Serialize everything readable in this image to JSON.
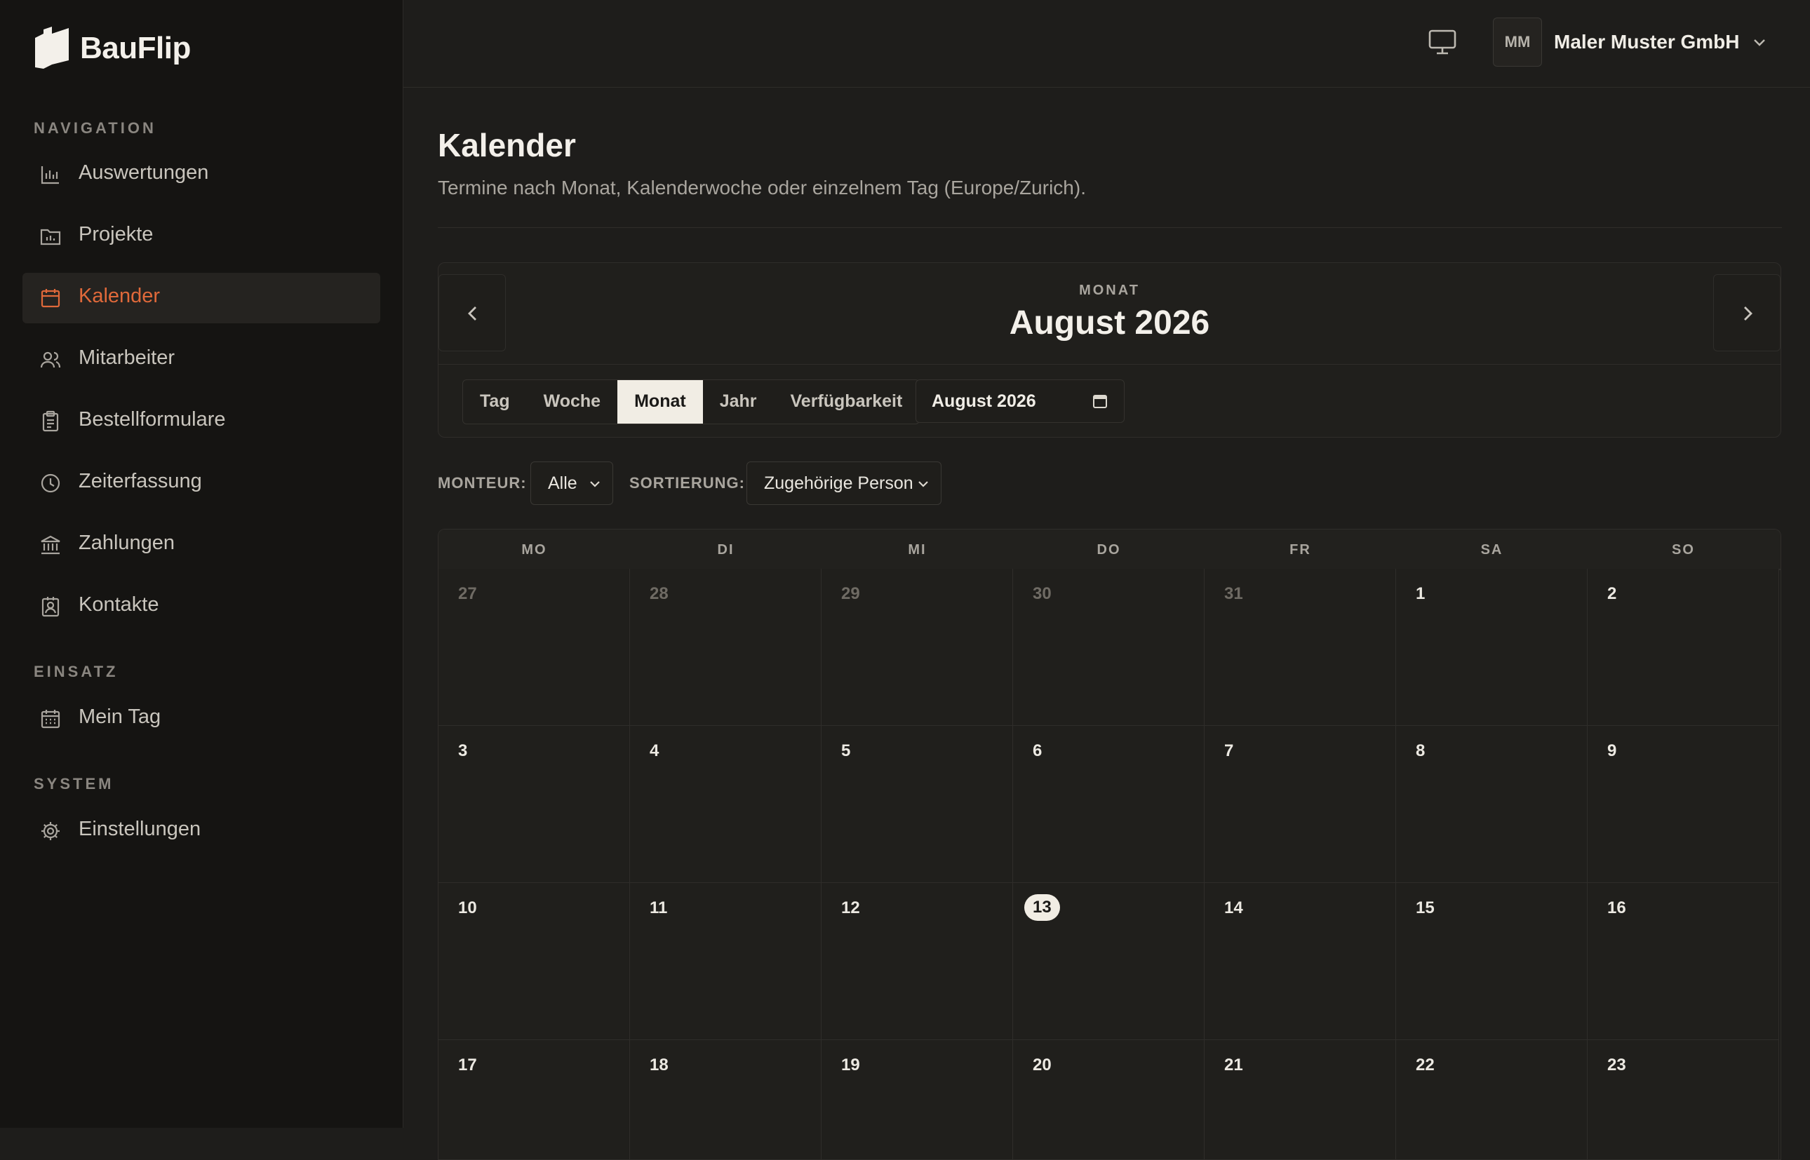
{
  "app": {
    "name": "BauFlip"
  },
  "sidebar": {
    "sections": [
      {
        "label": "NAVIGATION"
      },
      {
        "label": "EINSATZ"
      },
      {
        "label": "SYSTEM"
      }
    ],
    "items": [
      {
        "label": "Auswertungen",
        "icon": "bar-chart-icon"
      },
      {
        "label": "Projekte",
        "icon": "folder-chart-icon"
      },
      {
        "label": "Kalender",
        "icon": "calendar-icon",
        "active": true
      },
      {
        "label": "Mitarbeiter",
        "icon": "users-icon"
      },
      {
        "label": "Bestellformulare",
        "icon": "clipboard-icon"
      },
      {
        "label": "Zeiterfassung",
        "icon": "clock-icon"
      },
      {
        "label": "Zahlungen",
        "icon": "bank-icon"
      },
      {
        "label": "Kontakte",
        "icon": "contact-icon"
      },
      {
        "label": "Mein Tag",
        "icon": "calendar-grid-icon"
      },
      {
        "label": "Einstellungen",
        "icon": "gear-icon"
      }
    ],
    "accent_color": "#e0693a"
  },
  "header": {
    "avatar_initials": "MM",
    "company": "Maler Muster GmbH"
  },
  "page": {
    "title": "Kalender",
    "subtitle": "Termine nach Monat, Kalenderwoche oder einzelnem Tag (Europe/Zurich)."
  },
  "calendar": {
    "period_label": "MONAT",
    "period_title": "August 2026",
    "views": [
      "Tag",
      "Woche",
      "Monat",
      "Jahr",
      "Verfügbarkeit"
    ],
    "active_view": "Monat",
    "month_picker_value": "August 2026",
    "filters": {
      "monteur_label": "MONTEUR:",
      "monteur_value": "Alle",
      "sort_label": "SORTIERUNG:",
      "sort_value": "Zugehörige Person"
    },
    "weekdays": [
      "MO",
      "DI",
      "MI",
      "DO",
      "FR",
      "SA",
      "SO"
    ],
    "weeks": [
      [
        {
          "d": "27",
          "other": true
        },
        {
          "d": "28",
          "other": true
        },
        {
          "d": "29",
          "other": true
        },
        {
          "d": "30",
          "other": true
        },
        {
          "d": "31",
          "other": true
        },
        {
          "d": "1"
        },
        {
          "d": "2"
        }
      ],
      [
        {
          "d": "3"
        },
        {
          "d": "4"
        },
        {
          "d": "5"
        },
        {
          "d": "6"
        },
        {
          "d": "7"
        },
        {
          "d": "8"
        },
        {
          "d": "9"
        }
      ],
      [
        {
          "d": "10"
        },
        {
          "d": "11"
        },
        {
          "d": "12"
        },
        {
          "d": "13",
          "today": true
        },
        {
          "d": "14"
        },
        {
          "d": "15"
        },
        {
          "d": "16"
        }
      ],
      [
        {
          "d": "17"
        },
        {
          "d": "18"
        },
        {
          "d": "19"
        },
        {
          "d": "20"
        },
        {
          "d": "21"
        },
        {
          "d": "22"
        },
        {
          "d": "23"
        }
      ]
    ]
  }
}
